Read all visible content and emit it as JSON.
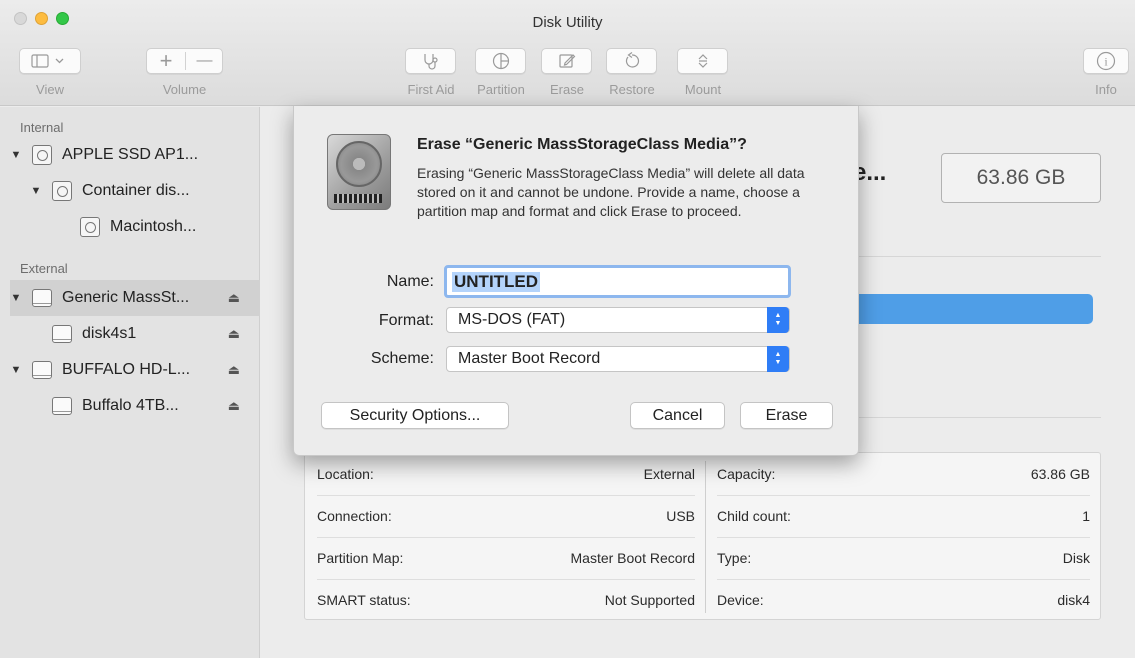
{
  "window": {
    "title": "Disk Utility"
  },
  "toolbar": {
    "view_label": "View",
    "volume_label": "Volume",
    "volume_add": "+",
    "volume_remove": "—",
    "first_aid_label": "First Aid",
    "partition_label": "Partition",
    "erase_label": "Erase",
    "restore_label": "Restore",
    "mount_label": "Mount",
    "info_label": "Info",
    "info_glyph": "i"
  },
  "sidebar": {
    "internal_header": "Internal",
    "external_header": "External",
    "items": [
      {
        "label": "APPLE SSD AP1...",
        "disclosure": "▼",
        "eject": ""
      },
      {
        "label": "Container dis...",
        "disclosure": "▼",
        "eject": ""
      },
      {
        "label": "Macintosh...",
        "disclosure": "",
        "eject": ""
      },
      {
        "label": "Generic MassSt...",
        "disclosure": "▼",
        "eject": "⏏",
        "selected": true
      },
      {
        "label": "disk4s1",
        "disclosure": "",
        "eject": "⏏"
      },
      {
        "label": "BUFFALO HD-L...",
        "disclosure": "▼",
        "eject": "⏏"
      },
      {
        "label": "Buffalo 4TB...",
        "disclosure": "",
        "eject": "⏏"
      }
    ]
  },
  "main": {
    "disk_title_partial": "e...",
    "capacity_box": "63.86 GB",
    "usage_color": "#4f9ee7",
    "info": {
      "left": [
        {
          "key": "Location:",
          "value": "External"
        },
        {
          "key": "Connection:",
          "value": "USB"
        },
        {
          "key": "Partition Map:",
          "value": "Master Boot Record"
        },
        {
          "key": "SMART status:",
          "value": "Not Supported"
        }
      ],
      "right": [
        {
          "key": "Capacity:",
          "value": "63.86 GB"
        },
        {
          "key": "Child count:",
          "value": "1"
        },
        {
          "key": "Type:",
          "value": "Disk"
        },
        {
          "key": "Device:",
          "value": "disk4"
        }
      ]
    }
  },
  "dialog": {
    "title": "Erase “Generic MassStorageClass Media”?",
    "message": "Erasing “Generic MassStorageClass Media” will delete all data stored on it and cannot be undone. Provide a name, choose a partition map and format and click Erase to proceed.",
    "name_label": "Name:",
    "name_value": "UNTITLED",
    "format_label": "Format:",
    "format_value": "MS-DOS (FAT)",
    "scheme_label": "Scheme:",
    "scheme_value": "Master Boot Record",
    "security_button": "Security Options...",
    "cancel_button": "Cancel",
    "erase_button": "Erase",
    "accent_color": "#2f7df6"
  }
}
